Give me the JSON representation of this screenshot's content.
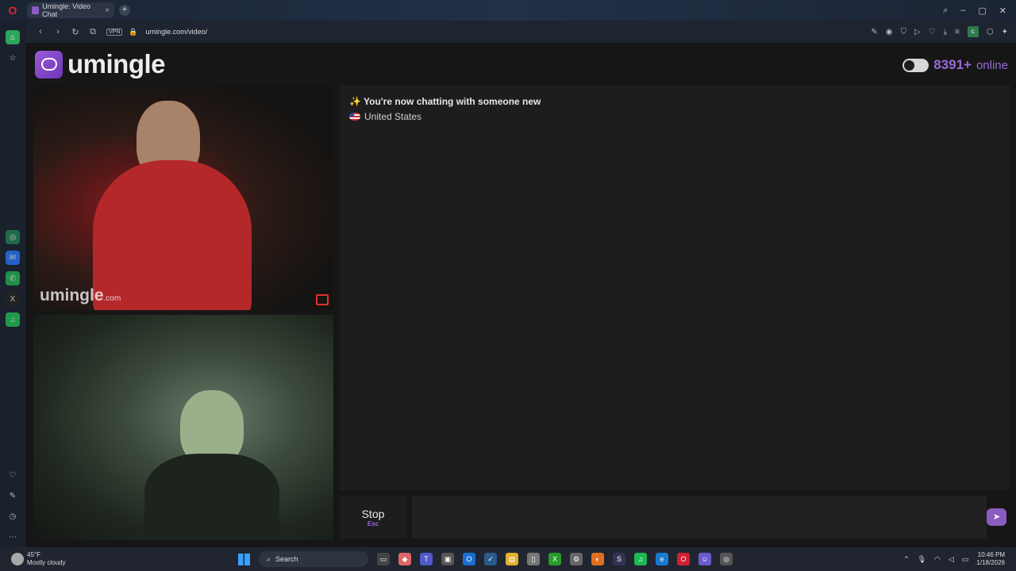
{
  "browser": {
    "tab_title": "Umingle: Video Chat",
    "url": "umingle.com/video/",
    "vpn_label": "VPN",
    "new_tab_label": "+"
  },
  "site": {
    "logo_text": "umingle",
    "online_count": "8391+",
    "online_label": "online",
    "watermark_main": "umingle",
    "watermark_suffix": ".com"
  },
  "chat": {
    "status_message": "✨ You're now chatting with someone new",
    "country": "United States",
    "input_value": ""
  },
  "controls": {
    "stop_label": "Stop",
    "stop_key": "Esc",
    "send_icon": "send-icon"
  },
  "taskbar": {
    "weather_temp": "45°F",
    "weather_desc": "Mostly cloudy",
    "search_label": "Search",
    "time": "10:46 PM",
    "date": "1/18/2026"
  },
  "colors": {
    "accent": "#9a6ad8",
    "page_bg": "#161616",
    "panel_bg": "#1d1d1d"
  }
}
